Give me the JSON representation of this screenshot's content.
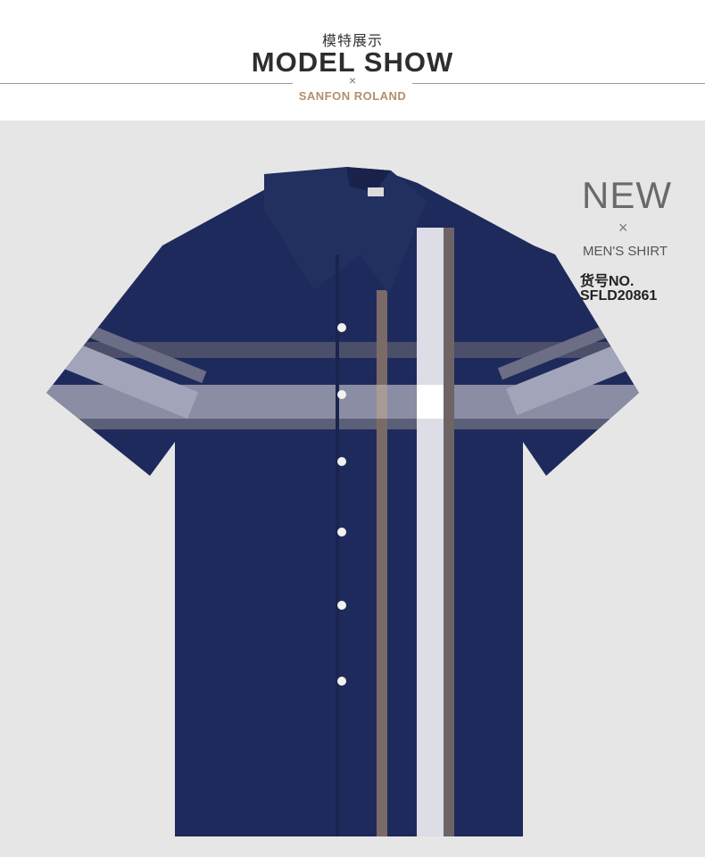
{
  "header": {
    "cn_title": "模特展示",
    "en_title": "MODEL SHOW",
    "separator": "×",
    "brand": "SANFON ROLAND"
  },
  "product": {
    "new_label": "NEW",
    "separator": "×",
    "category": "MEN'S SHIRT",
    "sku_label": "货号NO.",
    "sku": "SFLD20861"
  },
  "colors": {
    "shirt_navy": "#1f2a5c",
    "stripe_white": "#e6e6ef",
    "stripe_grey": "#8e8f9c",
    "stripe_brown": "#7a6b68",
    "brand_gold": "#b0906a",
    "background": "#e6e6e6"
  }
}
